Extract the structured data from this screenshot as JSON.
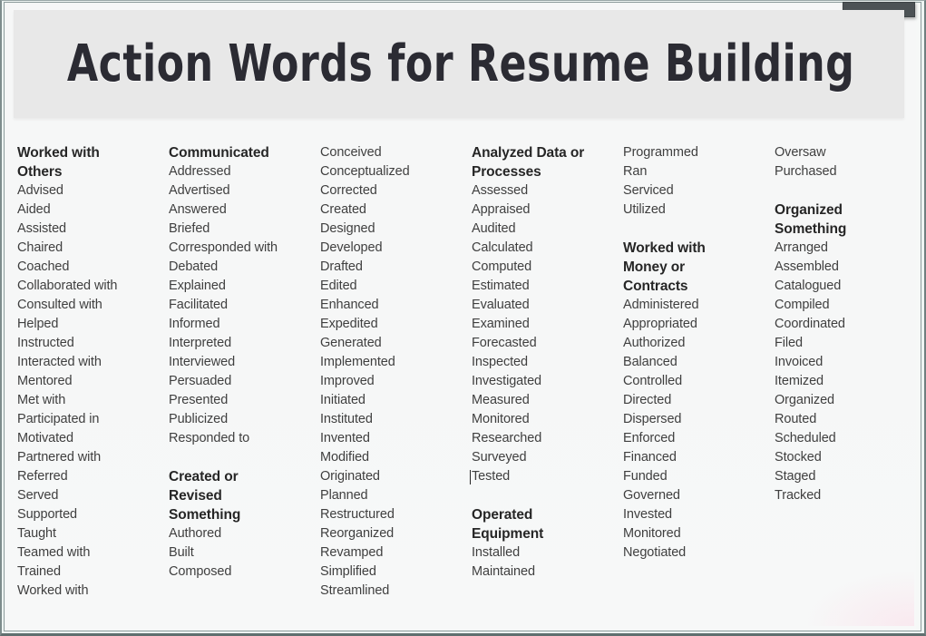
{
  "window": {
    "titlebar_chip_label": ""
  },
  "banner": {
    "title": "Action Words for Resume Building"
  },
  "columns": [
    {
      "name": "column-1",
      "blocks": [
        {
          "heading": "Worked with\nOthers",
          "words": [
            "Advised",
            "Aided",
            "Assisted",
            "Chaired",
            "Coached",
            "Collaborated with",
            "Consulted with",
            "Helped",
            "Instructed",
            "Interacted with",
            "Mentored",
            "Met with",
            "Participated in",
            "Motivated",
            "Partnered with",
            "Referred",
            "Served",
            "Supported",
            "Taught",
            "Teamed with",
            "Trained",
            "Worked with"
          ]
        }
      ]
    },
    {
      "name": "column-2",
      "blocks": [
        {
          "heading": "Communicated",
          "words": [
            "Addressed",
            "Advertised",
            "Answered",
            "Briefed",
            "Corresponded with",
            "Debated",
            "Explained",
            "Facilitated",
            "Informed",
            "Interpreted",
            "Interviewed",
            "Persuaded",
            "Presented",
            "Publicized",
            "Responded to"
          ]
        },
        {
          "heading": "Created or\nRevised\nSomething",
          "words": [
            "Authored",
            "Built",
            "Composed"
          ]
        }
      ]
    },
    {
      "name": "column-3",
      "blocks": [
        {
          "heading": "",
          "words": [
            "Conceived",
            "Conceptualized",
            "Corrected",
            "Created",
            "Designed",
            "Developed",
            "Drafted",
            "Edited",
            "Enhanced",
            "Expedited",
            "Generated",
            "Implemented",
            "Improved",
            "Initiated",
            "Instituted",
            "Invented",
            "Modified",
            "Originated",
            "Planned",
            "Restructured",
            "Reorganized",
            "Revamped",
            "Simplified",
            "Streamlined"
          ]
        }
      ]
    },
    {
      "name": "column-4",
      "blocks": [
        {
          "heading": "Analyzed Data or\nProcesses",
          "words": [
            "Assessed",
            "Appraised",
            "Audited",
            "Calculated",
            "Computed",
            "Estimated",
            "Evaluated",
            "Examined",
            "Forecasted",
            "Inspected",
            "Investigated",
            "Measured",
            "Monitored",
            "Researched",
            "Surveyed",
            "Tested"
          ]
        },
        {
          "heading": "Operated\nEquipment",
          "words": [
            "Installed",
            "Maintained"
          ]
        }
      ]
    },
    {
      "name": "column-5",
      "blocks": [
        {
          "heading": "",
          "words": [
            "Programmed",
            "Ran",
            "Serviced",
            "Utilized"
          ]
        },
        {
          "heading": "Worked with\nMoney or\nContracts",
          "words": [
            "Administered",
            "Appropriated",
            "Authorized",
            "Balanced",
            "Controlled",
            "Directed",
            "Dispersed",
            "Enforced",
            "Financed",
            "Funded",
            "Governed",
            "Invested",
            "Monitored",
            "Negotiated"
          ]
        }
      ]
    },
    {
      "name": "column-6",
      "blocks": [
        {
          "heading": "",
          "words": [
            "Oversaw",
            "Purchased"
          ]
        },
        {
          "heading": "Organized\nSomething",
          "words": [
            "Arranged",
            "Assembled",
            "Catalogued",
            "Compiled",
            "Coordinated",
            "Filed",
            "Invoiced",
            "Itemized",
            "Organized",
            "Routed",
            "Scheduled",
            "Stocked",
            "Staged",
            "Tracked"
          ]
        }
      ]
    }
  ],
  "caret": {
    "column_index": 3,
    "block_index": 0,
    "word_index": 15,
    "word": "Tested"
  },
  "colors": {
    "page_background": "#f6f7f7",
    "banner_background": "#e8e8e8",
    "title_text": "#2b2b33",
    "heading_text": "#262626",
    "body_text": "#3f3f3f",
    "frame_border": "#7d8c8c",
    "titlebar_chip": "#4c5255"
  }
}
